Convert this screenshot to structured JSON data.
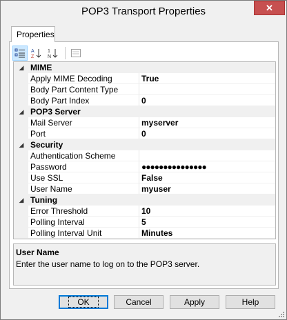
{
  "window": {
    "title": "POP3 Transport Properties",
    "close_glyph": "✕"
  },
  "tab": {
    "label": "Properties"
  },
  "toolbar": {
    "buttons": [
      "categorized-icon",
      "alphabetical-icon",
      "ordinal-icon",
      "property-pages-icon"
    ]
  },
  "grid": {
    "categories": [
      {
        "name": "MIME",
        "expand_glyph": "◢",
        "properties": [
          {
            "name": "Apply MIME Decoding",
            "value": "True"
          },
          {
            "name": "Body Part Content Type",
            "value": ""
          },
          {
            "name": "Body Part Index",
            "value": "0"
          }
        ]
      },
      {
        "name": "POP3 Server",
        "expand_glyph": "◢",
        "properties": [
          {
            "name": "Mail Server",
            "value": "myserver"
          },
          {
            "name": "Port",
            "value": "0"
          }
        ]
      },
      {
        "name": "Security",
        "expand_glyph": "◢",
        "properties": [
          {
            "name": "Authentication Scheme",
            "value": ""
          },
          {
            "name": "Password",
            "value": "●●●●●●●●●●●●●●●"
          },
          {
            "name": "Use SSL",
            "value": "False"
          },
          {
            "name": "User Name",
            "value": "myuser"
          }
        ]
      },
      {
        "name": "Tuning",
        "expand_glyph": "◢",
        "properties": [
          {
            "name": "Error Threshold",
            "value": "10"
          },
          {
            "name": "Polling Interval",
            "value": "5"
          },
          {
            "name": "Polling Interval Unit",
            "value": "Minutes"
          }
        ]
      }
    ]
  },
  "description": {
    "title": "User Name",
    "text": "Enter the user name to log on to the POP3 server."
  },
  "buttons": {
    "ok": "OK",
    "cancel": "Cancel",
    "apply": "Apply",
    "help": "Help"
  }
}
